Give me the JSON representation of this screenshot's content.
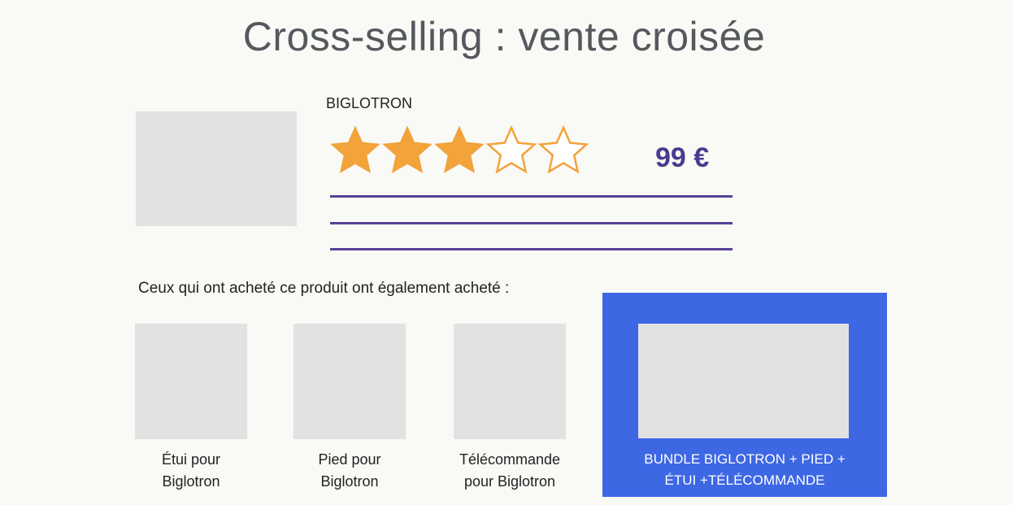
{
  "title": "Cross-selling : vente croisée",
  "product": {
    "name": "BIGLOTRON",
    "rating": 3,
    "rating_max": 5,
    "price": "99 €"
  },
  "colors": {
    "star": "#f2a33a",
    "accent": "#4b3a91",
    "bundle_bg": "#3d67e3"
  },
  "cross_sell": {
    "label": "Ceux qui ont acheté ce produit ont également acheté :",
    "items": [
      {
        "caption": "Étui pour\nBiglotron"
      },
      {
        "caption": "Pied pour\nBiglotron"
      },
      {
        "caption": "Télécommande\npour Biglotron"
      }
    ],
    "bundle": {
      "caption": "BUNDLE BIGLOTRON + PIED +\nÉTUI +TÉLÉCOMMANDE"
    }
  }
}
